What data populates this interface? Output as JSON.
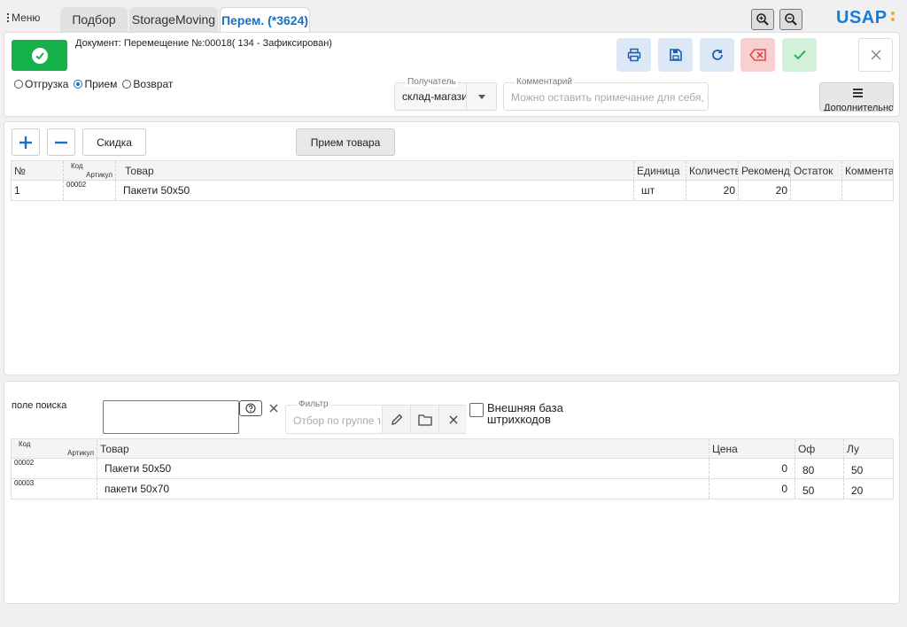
{
  "topbar": {
    "menu_label": "Меню",
    "tabs": [
      {
        "label": "Подбор"
      },
      {
        "label": "StorageMoving"
      },
      {
        "label": "Перем. (*3624)"
      }
    ],
    "logo": "USAP"
  },
  "document": {
    "title": "Документ: Перемещение №:00018( 134 - Зафиксирован)",
    "radios": [
      {
        "label": "Отгрузка",
        "checked": false
      },
      {
        "label": "Прием",
        "checked": true
      },
      {
        "label": "Возврат",
        "checked": false
      }
    ],
    "recipient_label": "Получатель",
    "recipient_value": "склад-магази",
    "comment_label": "Комментарий",
    "comment_placeholder": "Можно оставить примечание для себя, или",
    "more_label": "Дополнительно"
  },
  "colors": {
    "accent": "#1a6fc7",
    "ok_green": "#17b14b",
    "danger_red": "#e04a4a",
    "logo_dots": "#f5a623"
  },
  "items_toolbar": {
    "discount_label": "Скидка",
    "receive_label": "Прием товара"
  },
  "items_table": {
    "headers": {
      "num": "№",
      "kod": "Код",
      "art": "Артикул",
      "product": "Товар",
      "unit": "Единица",
      "qty": "Количество",
      "rec": "Рекомендовано",
      "stock": "Остаток",
      "comment": "Комментарий"
    },
    "rows": [
      {
        "num": "1",
        "code": "00002",
        "product": "Пакети 50х50",
        "unit": "шт",
        "qty": "20",
        "rec": "20",
        "stock": "",
        "comment": ""
      }
    ]
  },
  "search": {
    "label": "поле поиска",
    "value": "",
    "filter_label": "Фильтр",
    "filter_placeholder": "Отбор по группе товаров",
    "external_db_label": "Внешняя база штрихкодов"
  },
  "catalog_table": {
    "headers": {
      "kod": "Код",
      "art": "Артикул",
      "product": "Товар",
      "price": "Цена",
      "of": "Оф",
      "lu": "Лу"
    },
    "rows": [
      {
        "code": "00002",
        "product": "Пакети 50х50",
        "price": "0",
        "of": "80",
        "lu": "50"
      },
      {
        "code": "00003",
        "product": "пакети 50х70",
        "price": "0",
        "of": "50",
        "lu": "20"
      }
    ]
  }
}
